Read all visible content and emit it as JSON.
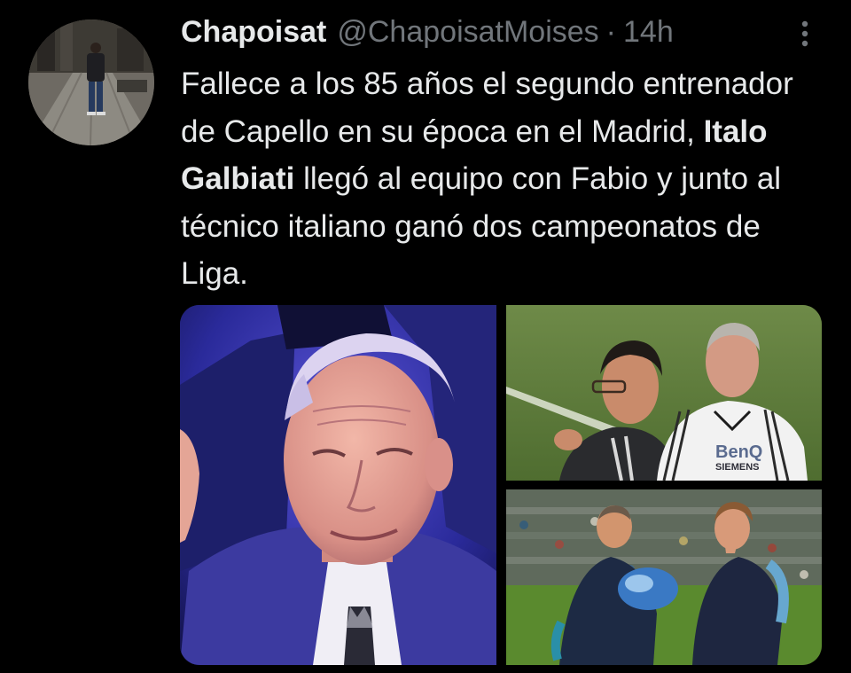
{
  "tweet": {
    "display_name": "Chapoisat",
    "handle": "@ChapoisatMoises",
    "separator": "·",
    "time": "14h",
    "more_icon": "more-vertical-icon",
    "text_part1": "Fallece a los 85 años el segundo entrenador de Capello en su época en el Madrid, ",
    "text_bold": "Italo Galbiati",
    "text_part2": " llegó al equipo con Fabio y junto al técnico italiano ganó dos campeonatos de Liga."
  },
  "media": {
    "count": 3,
    "jersey_brand": "BenQ",
    "jersey_sponsor": "SIEMENS"
  },
  "colors": {
    "background": "#000000",
    "text_primary": "#e7e9ea",
    "text_secondary": "#71767b"
  }
}
